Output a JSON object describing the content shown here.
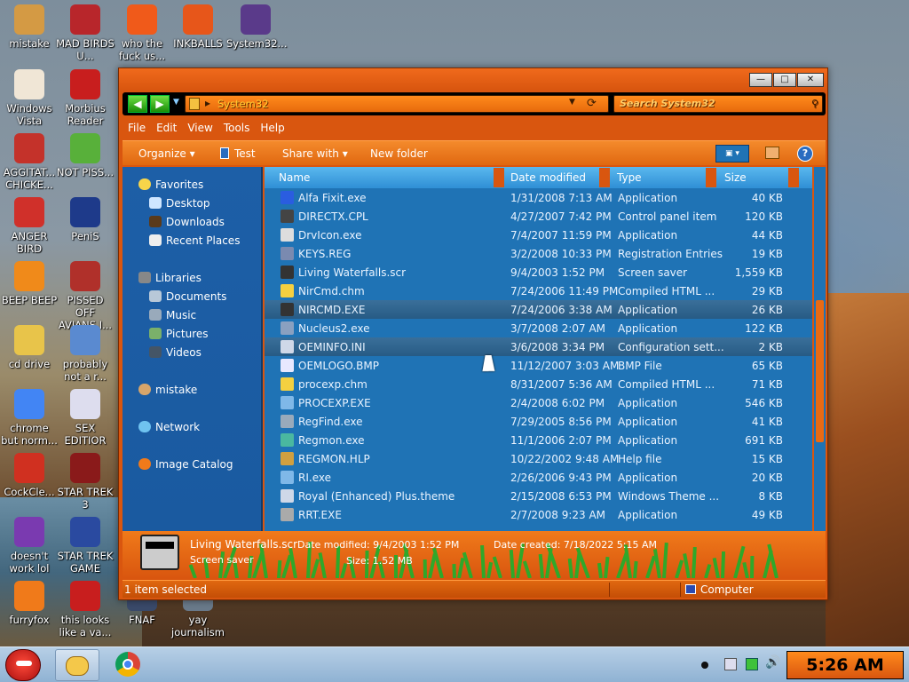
{
  "desktop": {
    "icons": [
      {
        "label": "mistake"
      },
      {
        "label": "MAD BIRDS U..."
      },
      {
        "label": "who the fuck us..."
      },
      {
        "label": "INKBALLS"
      },
      {
        "label": "System32..."
      },
      {
        "label": "Windows Vista"
      },
      {
        "label": "Morbius Reader"
      },
      {
        "label": "AGGITAT... CHICKE..."
      },
      {
        "label": "NOT PISS..."
      },
      {
        "label": "ANGER BIRD"
      },
      {
        "label": "PeniS"
      },
      {
        "label": "BEEP BEEP"
      },
      {
        "label": "PISSED OFF AVIANS I..."
      },
      {
        "label": "cd drive"
      },
      {
        "label": "probably not a r..."
      },
      {
        "label": "chrome but norm..."
      },
      {
        "label": "SEX EDITIOR"
      },
      {
        "label": "CockCle..."
      },
      {
        "label": "STAR TREK 3"
      },
      {
        "label": "doesn't work lol"
      },
      {
        "label": "STAR TREK GAME"
      },
      {
        "label": "furryfox"
      },
      {
        "label": "this looks like a va..."
      },
      {
        "label": "FNAF"
      },
      {
        "label": "yay journalism"
      }
    ]
  },
  "window": {
    "address": "System32",
    "search_placeholder": "Search System32",
    "menu": [
      "File",
      "Edit",
      "View",
      "Tools",
      "Help"
    ],
    "toolbar": {
      "organize": "Organize",
      "test": "Test",
      "share": "Share with",
      "new_folder": "New folder"
    },
    "nav": {
      "favorites": "Favorites",
      "desktop": "Desktop",
      "downloads": "Downloads",
      "recent": "Recent Places",
      "libraries": "Libraries",
      "documents": "Documents",
      "music": "Music",
      "pictures": "Pictures",
      "videos": "Videos",
      "mistake": "mistake",
      "network": "Network",
      "image_catalog": "Image Catalog"
    },
    "columns": {
      "name": "Name",
      "date": "Date modified",
      "type": "Type",
      "size": "Size"
    },
    "files": [
      {
        "name": "Alfa Fixit.exe",
        "date": "1/31/2008 7:13 AM",
        "type": "Application",
        "size": "40 KB"
      },
      {
        "name": "DIRECTX.CPL",
        "date": "4/27/2007 7:42 PM",
        "type": "Control panel item",
        "size": "120 KB"
      },
      {
        "name": "DrvIcon.exe",
        "date": "7/4/2007 11:59 PM",
        "type": "Application",
        "size": "44 KB"
      },
      {
        "name": "KEYS.REG",
        "date": "3/2/2008 10:33 PM",
        "type": "Registration Entries",
        "size": "19 KB"
      },
      {
        "name": "Living Waterfalls.scr",
        "date": "9/4/2003 1:52 PM",
        "type": "Screen saver",
        "size": "1,559 KB"
      },
      {
        "name": "NirCmd.chm",
        "date": "7/24/2006 11:49 PM",
        "type": "Compiled HTML ...",
        "size": "29 KB"
      },
      {
        "name": "NIRCMD.EXE",
        "date": "7/24/2006 3:38 AM",
        "type": "Application",
        "size": "26 KB"
      },
      {
        "name": "Nucleus2.exe",
        "date": "3/7/2008 2:07 AM",
        "type": "Application",
        "size": "122 KB"
      },
      {
        "name": "OEMINFO.INI",
        "date": "3/6/2008 3:34 PM",
        "type": "Configuration sett...",
        "size": "2 KB"
      },
      {
        "name": "OEMLOGO.BMP",
        "date": "11/12/2007 3:03 AM",
        "type": "BMP File",
        "size": "65 KB"
      },
      {
        "name": "procexp.chm",
        "date": "8/31/2007 5:36 AM",
        "type": "Compiled HTML ...",
        "size": "71 KB"
      },
      {
        "name": "PROCEXP.EXE",
        "date": "2/4/2008 6:02 PM",
        "type": "Application",
        "size": "546 KB"
      },
      {
        "name": "RegFind.exe",
        "date": "7/29/2005 8:56 PM",
        "type": "Application",
        "size": "41 KB"
      },
      {
        "name": "Regmon.exe",
        "date": "11/1/2006 2:07 PM",
        "type": "Application",
        "size": "691 KB"
      },
      {
        "name": "REGMON.HLP",
        "date": "10/22/2002 9:48 AM",
        "type": "Help file",
        "size": "15 KB"
      },
      {
        "name": "RI.exe",
        "date": "2/26/2006 9:43 PM",
        "type": "Application",
        "size": "20 KB"
      },
      {
        "name": "Royal (Enhanced) Plus.theme",
        "date": "2/15/2008 6:53 PM",
        "type": "Windows Theme ...",
        "size": "8 KB"
      },
      {
        "name": "RRT.EXE",
        "date": "2/7/2008 9:23 AM",
        "type": "Application",
        "size": "49 KB"
      }
    ],
    "details": {
      "name": "Living Waterfalls.scr",
      "kind": "Screen saver",
      "modified": "Date modified: 9/4/2003 1:52 PM",
      "size": "Size: 1.52 MB",
      "created": "Date created: 7/18/2022 5:15 AM"
    },
    "status": {
      "selected": "1 item selected",
      "location": "Computer"
    }
  },
  "taskbar": {
    "clock": "5:26 AM"
  },
  "colors": {
    "accent": "#d9560f",
    "pane": "#1f73b5",
    "nav": "#1d5fa7"
  }
}
